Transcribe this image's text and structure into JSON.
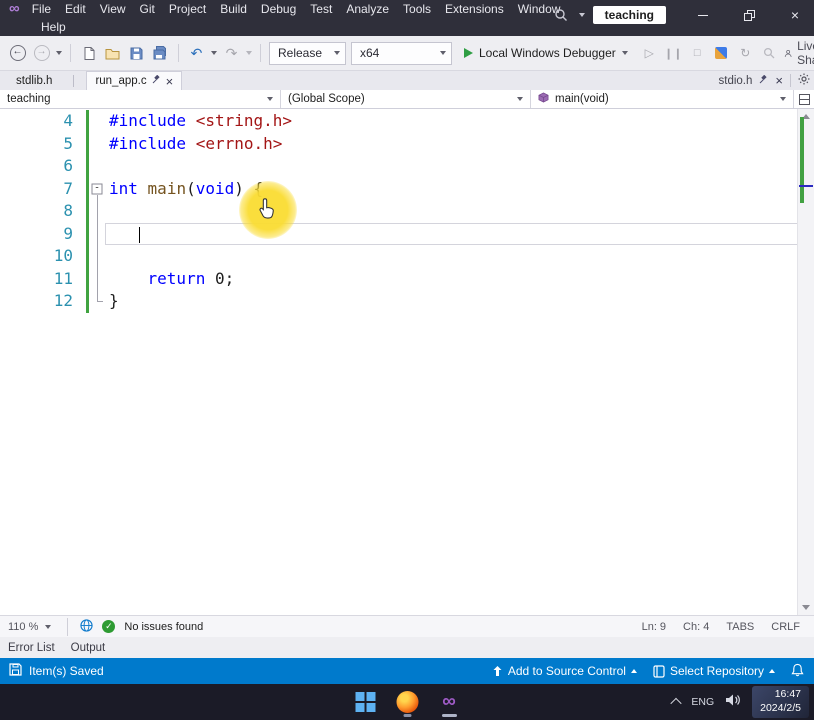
{
  "title_bar": {
    "menus_row1": [
      "File",
      "Edit",
      "View",
      "Git",
      "Project",
      "Build",
      "Debug",
      "Test",
      "Analyze",
      "Tools",
      "Extensions",
      "Window"
    ],
    "menus_row2": [
      "Help"
    ],
    "search_value": "teaching"
  },
  "toolbar": {
    "configuration": "Release",
    "platform": "x64",
    "debug_target": "Local Windows Debugger",
    "live_share": "Live Share"
  },
  "tab_bar": {
    "tabs": [
      {
        "label": "stdlib.h",
        "active": false
      },
      {
        "label": "run_app.c",
        "active": true
      }
    ],
    "right_tab": "stdio.h"
  },
  "nav_bar": {
    "project": "teaching",
    "scope": "(Global Scope)",
    "member": "main(void)"
  },
  "editor": {
    "colors": {
      "keyword": "#0000ff",
      "string": "#a31515",
      "function": "#74531f",
      "line_number": "#2b91af",
      "saved_change_bar": "#40a340",
      "highlight_circle": "#fadc32"
    },
    "lines": [
      {
        "num": "4",
        "changed": true,
        "fold": null,
        "segments": [
          [
            "pp",
            "#include "
          ],
          [
            "str",
            "<string.h>"
          ]
        ]
      },
      {
        "num": "5",
        "changed": true,
        "fold": null,
        "segments": [
          [
            "pp",
            "#include "
          ],
          [
            "str",
            "<errno.h>"
          ]
        ]
      },
      {
        "num": "6",
        "changed": true,
        "fold": null,
        "segments": []
      },
      {
        "num": "7",
        "changed": true,
        "fold": "start",
        "segments": [
          [
            "kw",
            "int"
          ],
          [
            "pl",
            " "
          ],
          [
            "fn",
            "main"
          ],
          [
            "pl",
            "("
          ],
          [
            "kw",
            "void"
          ],
          [
            "pl",
            ") {"
          ]
        ]
      },
      {
        "num": "8",
        "changed": true,
        "fold": "mid",
        "segments": []
      },
      {
        "num": "9",
        "changed": true,
        "fold": "mid",
        "current": true,
        "caret": true,
        "caret_indent": "   ",
        "segments": []
      },
      {
        "num": "10",
        "changed": true,
        "fold": "mid",
        "segments": []
      },
      {
        "num": "11",
        "changed": true,
        "fold": "mid",
        "segments": [
          [
            "pl",
            "    "
          ],
          [
            "kw",
            "return"
          ],
          [
            "pl",
            " 0;"
          ]
        ]
      },
      {
        "num": "12",
        "changed": true,
        "fold": "end",
        "segments": [
          [
            "pl",
            "}"
          ]
        ]
      }
    ]
  },
  "editor_status": {
    "zoom": "110 %",
    "issues": "No issues found",
    "line": "Ln: 9",
    "column": "Ch: 4",
    "indent": "TABS",
    "eol": "CRLF"
  },
  "panel_tabs": [
    "Error List",
    "Output"
  ],
  "status_bar": {
    "message": "Item(s) Saved",
    "add_source_control": "Add to Source Control",
    "select_repository": "Select Repository"
  },
  "taskbar": {
    "language": "ENG",
    "time": "16:47",
    "date": "2024/2/5"
  }
}
